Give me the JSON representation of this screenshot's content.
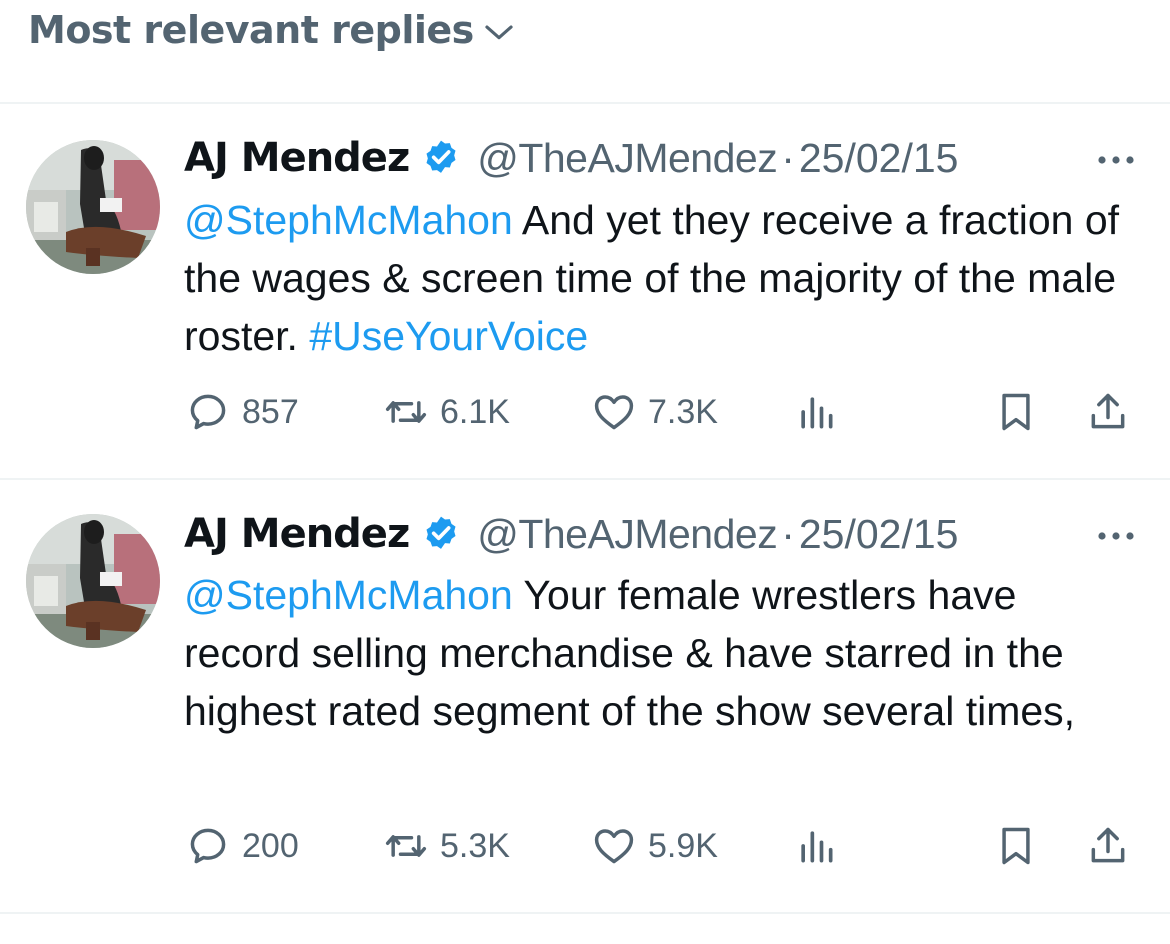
{
  "header": {
    "sort_label": "Most relevant replies"
  },
  "tweets": [
    {
      "name": "AJ Mendez",
      "handle": "@TheAJMendez",
      "separator": "·",
      "date": "25/02/15",
      "mention": "@StephMcMahon",
      "text": " And yet they receive a fraction of the wages & screen time of the majority of the male roster. ",
      "hashtag": "#UseYourVoice",
      "replies": "857",
      "reposts": "6.1K",
      "likes": "7.3K"
    },
    {
      "name": "AJ Mendez",
      "handle": "@TheAJMendez",
      "separator": "·",
      "date": "25/02/15",
      "mention": "@StephMcMahon",
      "text": " Your female wrestlers have record selling merchandise & have starred in the highest rated segment of the show several times,",
      "replies": "200",
      "reposts": "5.3K",
      "likes": "5.9K"
    }
  ],
  "icons": {
    "chevron": "chevron-down-icon",
    "verified": "verified-badge-icon",
    "more": "more-icon",
    "reply": "reply-icon",
    "repost": "repost-icon",
    "like": "heart-icon",
    "views": "views-icon",
    "bookmark": "bookmark-icon",
    "share": "share-icon"
  },
  "colors": {
    "link": "#1d9bf0",
    "secondary": "#536471",
    "text": "#0f1419",
    "divider": "#eff3f4"
  }
}
